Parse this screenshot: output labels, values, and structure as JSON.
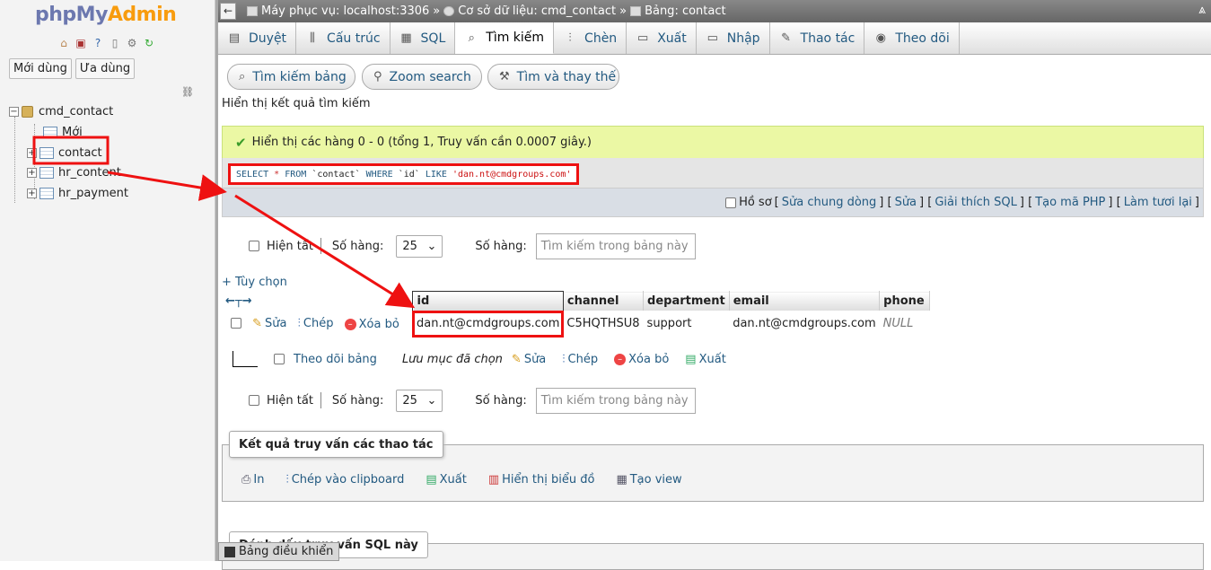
{
  "nav": {
    "logo_php": "php",
    "logo_my": "My",
    "logo_admin": "Admin",
    "tab_recent": "Mới dùng",
    "tab_favorites": "Ưa dùng",
    "database": "cmd_contact",
    "new_item": "Mới",
    "tables": [
      "contact",
      "hr_content",
      "hr_payment"
    ]
  },
  "breadcrumb": {
    "server": "Máy phục vụ: localhost:3306",
    "database": "Cơ sở dữ liệu: cmd_contact",
    "table": "Bảng: contact",
    "separator": "»"
  },
  "tabs": [
    {
      "label": "Duyệt",
      "icon": "browse-icon"
    },
    {
      "label": "Cấu trúc",
      "icon": "structure-icon"
    },
    {
      "label": "SQL",
      "icon": "sql-icon"
    },
    {
      "label": "Tìm kiếm",
      "icon": "search-icon"
    },
    {
      "label": "Chèn",
      "icon": "insert-icon"
    },
    {
      "label": "Xuất",
      "icon": "export-icon"
    },
    {
      "label": "Nhập",
      "icon": "import-icon"
    },
    {
      "label": "Thao tác",
      "icon": "operations-icon"
    },
    {
      "label": "Theo dõi",
      "icon": "tracking-icon"
    }
  ],
  "search_tabs": {
    "table_search": "Tìm kiếm bảng",
    "zoom_search": "Zoom search",
    "find_replace": "Tìm và thay thế"
  },
  "results_label": "Hiển thị kết quả tìm kiếm",
  "success_message": "Hiển thị các hàng 0 - 0 (tổng 1, Truy vấn cần 0.0007 giây.)",
  "sql": {
    "select": "SELECT",
    "star": "*",
    "from": "FROM",
    "table": "`contact`",
    "where": "WHERE",
    "column": "`id`",
    "like": "LIKE",
    "value": "'dan.nt@cmdgroups.com'"
  },
  "sql_options": {
    "profiling": "Hồ sơ",
    "edit_inline": "Sửa chung dòng",
    "edit": "Sửa",
    "explain": "Giải thích SQL",
    "create_php": "Tạo mã PHP",
    "refresh": "Làm tươi lại"
  },
  "navigation": {
    "show_all": "Hiện tất",
    "rows_label": "Số hàng:",
    "rows_value": "25",
    "filter_label": "Số hàng:",
    "filter_placeholder": "Tìm kiếm trong bảng này"
  },
  "options_link": "+ Tùy chọn",
  "table": {
    "columns": [
      "id",
      "channel",
      "department",
      "email",
      "phone"
    ],
    "rows": [
      {
        "edit": "Sửa",
        "copy": "Chép",
        "delete": "Xóa bỏ",
        "id": "dan.nt@cmdgroups.com",
        "channel": "C5HQTHSU8",
        "department": "support",
        "email": "dan.nt@cmdgroups.com",
        "phone": "NULL"
      }
    ]
  },
  "bulk": {
    "check_all": "Theo dõi bảng",
    "with_selected": "Lưu mục đã chọn",
    "edit": "Sửa",
    "copy": "Chép",
    "delete": "Xóa bỏ",
    "export": "Xuất"
  },
  "query_ops": {
    "legend": "Kết quả truy vấn các thao tác",
    "print": "In",
    "copy_clipboard": "Chép vào clipboard",
    "export": "Xuất",
    "chart": "Hiển thị biểu đồ",
    "create_view": "Tạo view"
  },
  "bookmark_legend": "Đánh dấu truy vấn SQL này",
  "console_label": "Bảng điều khiển",
  "colors": {
    "link": "#235a81",
    "annotation": "#e11111",
    "success_bg": "#ebf8a4"
  }
}
